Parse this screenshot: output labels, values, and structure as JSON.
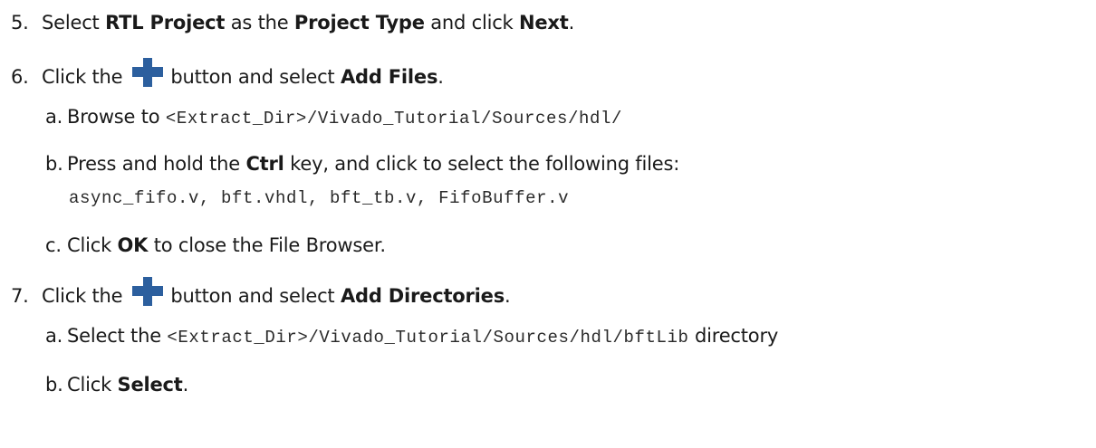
{
  "steps": {
    "s5": {
      "number": "5.",
      "t1": "Select ",
      "b1": "RTL Project",
      "t2": " as the ",
      "b2": "Project Type",
      "t3": " and click ",
      "b3": "Next",
      "t4": "."
    },
    "s6": {
      "number": "6.",
      "t1": "Click the ",
      "t2": " button and select ",
      "b1": "Add Files",
      "t3": ".",
      "a": {
        "letter": "a.",
        "text": "Browse to ",
        "code": "<Extract_Dir>/Vivado_Tutorial/Sources/hdl/"
      },
      "b": {
        "letter": "b.",
        "t1": "Press and hold the ",
        "b1": "Ctrl",
        "t2": " key, and click to select the following files:",
        "code": "async_fifo.v, bft.vhdl, bft_tb.v, FifoBuffer.v"
      },
      "c": {
        "letter": "c.",
        "t1": "Click ",
        "b1": "OK",
        "t2": " to close the File Browser."
      }
    },
    "s7": {
      "number": "7.",
      "t1": "Click the ",
      "t2": " button and select ",
      "b1": "Add Directories",
      "t3": ".",
      "a": {
        "letter": "a.",
        "text": "Select the ",
        "code": "<Extract_Dir>/Vivado_Tutorial/Sources/hdl/bftLib",
        "t2": " directory"
      },
      "b": {
        "letter": "b.",
        "t1": "Click ",
        "b1": "Select",
        "t2": "."
      }
    }
  },
  "colors": {
    "plus_icon": "#2c5f9e"
  },
  "icons": {
    "add": "plus-icon"
  }
}
